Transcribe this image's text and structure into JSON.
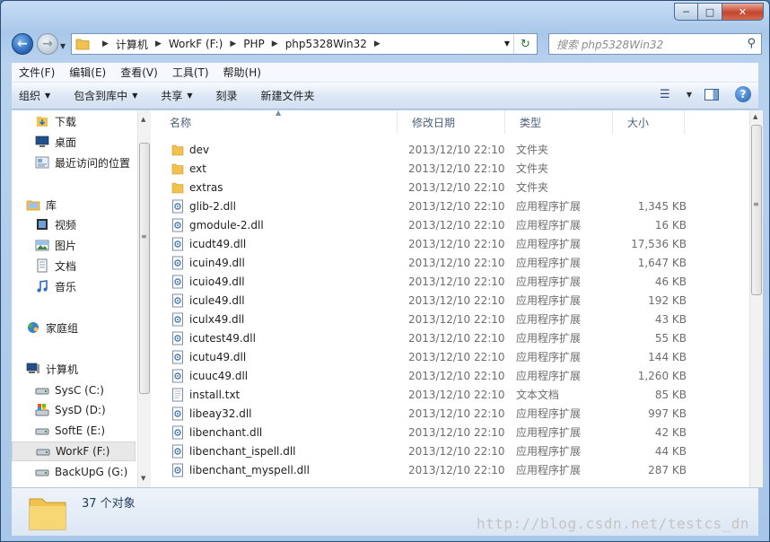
{
  "colors": {
    "accent": "#2b6cbf",
    "folder": "#f2c24f",
    "close": "#c5452d"
  },
  "window": {
    "minimize_icon": "minimize-icon",
    "maximize_icon": "maximize-icon",
    "close_icon": "close-icon"
  },
  "address": {
    "crumbs": [
      "计算机",
      "WorkF (F:)",
      "PHP",
      "php5328Win32"
    ],
    "search_placeholder": "搜索 php5328Win32"
  },
  "menu": [
    "文件(F)",
    "编辑(E)",
    "查看(V)",
    "工具(T)",
    "帮助(H)"
  ],
  "toolbar": {
    "organize": "组织",
    "include_in_library": "包含到库中",
    "share": "共享",
    "burn": "刻录",
    "new_folder": "新建文件夹"
  },
  "sidebar": {
    "favorites": [
      {
        "label": "下载",
        "icon": "download-folder-icon"
      },
      {
        "label": "桌面",
        "icon": "desktop-icon"
      },
      {
        "label": "最近访问的位置",
        "icon": "recent-places-icon"
      }
    ],
    "libraries_label": "库",
    "libraries": [
      {
        "label": "视频",
        "icon": "video-library-icon"
      },
      {
        "label": "图片",
        "icon": "pictures-library-icon"
      },
      {
        "label": "文档",
        "icon": "documents-library-icon"
      },
      {
        "label": "音乐",
        "icon": "music-library-icon"
      }
    ],
    "homegroup": "家庭组",
    "computer_label": "计算机",
    "drives": [
      {
        "label": "SysC (C:)"
      },
      {
        "label": "SysD (D:)"
      },
      {
        "label": "SoftE (E:)"
      },
      {
        "label": "WorkF (F:)",
        "selected": true
      },
      {
        "label": "BackUpG (G:)"
      }
    ]
  },
  "columns": {
    "name": "名称",
    "date": "修改日期",
    "type": "类型",
    "size": "大小"
  },
  "files": [
    {
      "name": "dev",
      "date": "2013/12/10 22:10",
      "type": "文件夹",
      "size": "",
      "kind": "folder"
    },
    {
      "name": "ext",
      "date": "2013/12/10 22:10",
      "type": "文件夹",
      "size": "",
      "kind": "folder"
    },
    {
      "name": "extras",
      "date": "2013/12/10 22:10",
      "type": "文件夹",
      "size": "",
      "kind": "folder"
    },
    {
      "name": "glib-2.dll",
      "date": "2013/12/10 22:10",
      "type": "应用程序扩展",
      "size": "1,345 KB",
      "kind": "dll"
    },
    {
      "name": "gmodule-2.dll",
      "date": "2013/12/10 22:10",
      "type": "应用程序扩展",
      "size": "16 KB",
      "kind": "dll"
    },
    {
      "name": "icudt49.dll",
      "date": "2013/12/10 22:10",
      "type": "应用程序扩展",
      "size": "17,536 KB",
      "kind": "dll"
    },
    {
      "name": "icuin49.dll",
      "date": "2013/12/10 22:10",
      "type": "应用程序扩展",
      "size": "1,647 KB",
      "kind": "dll"
    },
    {
      "name": "icuio49.dll",
      "date": "2013/12/10 22:10",
      "type": "应用程序扩展",
      "size": "46 KB",
      "kind": "dll"
    },
    {
      "name": "icule49.dll",
      "date": "2013/12/10 22:10",
      "type": "应用程序扩展",
      "size": "192 KB",
      "kind": "dll"
    },
    {
      "name": "iculx49.dll",
      "date": "2013/12/10 22:10",
      "type": "应用程序扩展",
      "size": "43 KB",
      "kind": "dll"
    },
    {
      "name": "icutest49.dll",
      "date": "2013/12/10 22:10",
      "type": "应用程序扩展",
      "size": "55 KB",
      "kind": "dll"
    },
    {
      "name": "icutu49.dll",
      "date": "2013/12/10 22:10",
      "type": "应用程序扩展",
      "size": "144 KB",
      "kind": "dll"
    },
    {
      "name": "icuuc49.dll",
      "date": "2013/12/10 22:10",
      "type": "应用程序扩展",
      "size": "1,260 KB",
      "kind": "dll"
    },
    {
      "name": "install.txt",
      "date": "2013/12/10 22:10",
      "type": "文本文档",
      "size": "85 KB",
      "kind": "txt"
    },
    {
      "name": "libeay32.dll",
      "date": "2013/12/10 22:10",
      "type": "应用程序扩展",
      "size": "997 KB",
      "kind": "dll"
    },
    {
      "name": "libenchant.dll",
      "date": "2013/12/10 22:10",
      "type": "应用程序扩展",
      "size": "42 KB",
      "kind": "dll"
    },
    {
      "name": "libenchant_ispell.dll",
      "date": "2013/12/10 22:10",
      "type": "应用程序扩展",
      "size": "44 KB",
      "kind": "dll"
    },
    {
      "name": "libenchant_myspell.dll",
      "date": "2013/12/10 22:10",
      "type": "应用程序扩展",
      "size": "287 KB",
      "kind": "dll"
    }
  ],
  "status": {
    "count": "37 个对象"
  },
  "watermark": "http://blog.csdn.net/testcs_dn"
}
